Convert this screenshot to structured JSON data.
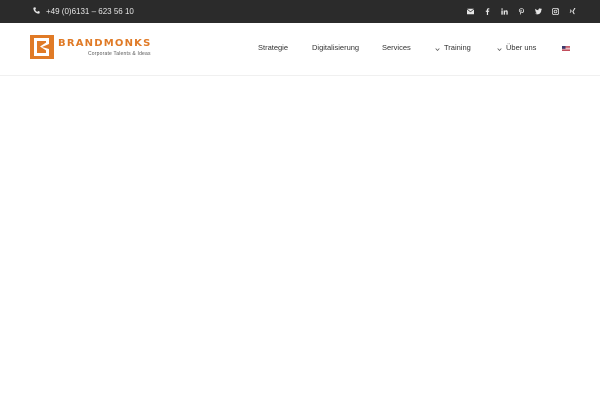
{
  "topbar": {
    "phone_icon": "phone-icon",
    "phone": "+49 (0)6131 – 623 56 10",
    "social_icons": [
      "envelope-icon",
      "facebook-icon",
      "linkedin-icon",
      "pinterest-icon",
      "twitter-icon",
      "instagram-icon",
      "xing-icon"
    ]
  },
  "header": {
    "logo": {
      "wordmark": "BRANDMONKS",
      "tagline": "Corporate Talents & Ideas"
    },
    "nav": [
      {
        "label": "Strategie"
      },
      {
        "label": "Digitalisierung"
      },
      {
        "label": "Services"
      },
      {
        "label": "Training",
        "has_dropdown": true
      },
      {
        "label": "Über uns",
        "has_dropdown": true
      }
    ],
    "language_icon": "us-flag-icon"
  },
  "colors": {
    "topbar_bg": "#2b2b2b",
    "brand_orange": "#e07a26",
    "nav_text": "#333333"
  }
}
